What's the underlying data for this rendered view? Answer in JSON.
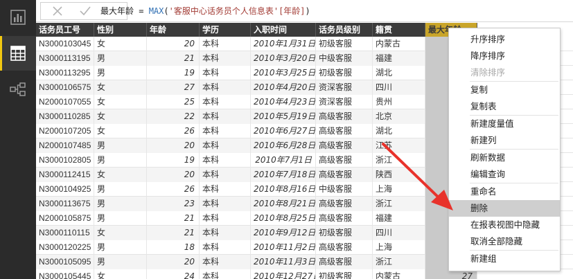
{
  "formula": {
    "measure": "最大年龄",
    "op": " = ",
    "fn": "MAX",
    "open": "(",
    "table": "'客服中心话务员个人信息表'",
    "column": "[年龄]",
    "close": ")"
  },
  "columns": [
    "话务员工号",
    "性别",
    "年龄",
    "学历",
    "入职时间",
    "话务员级别",
    "籍贯",
    "最大年龄"
  ],
  "rows": [
    [
      "N3000103045",
      "女",
      "20",
      "本科",
      "2010年1月31日",
      "初级客服",
      "内蒙古",
      ""
    ],
    [
      "N3000113195",
      "男",
      "21",
      "本科",
      "2010年3月20日",
      "中级客服",
      "福建",
      ""
    ],
    [
      "N3000113295",
      "男",
      "19",
      "本科",
      "2010年3月25日",
      "初级客服",
      "湖北",
      ""
    ],
    [
      "N3000106575",
      "女",
      "27",
      "本科",
      "2010年4月20日",
      "资深客服",
      "四川",
      ""
    ],
    [
      "N2000107055",
      "女",
      "25",
      "本科",
      "2010年4月23日",
      "资深客服",
      "贵州",
      ""
    ],
    [
      "N3000110285",
      "女",
      "22",
      "本科",
      "2010年5月19日",
      "高级客服",
      "北京",
      ""
    ],
    [
      "N2000107205",
      "女",
      "26",
      "本科",
      "2010年6月27日",
      "高级客服",
      "湖北",
      ""
    ],
    [
      "N2000107485",
      "男",
      "20",
      "本科",
      "2010年6月28日",
      "高级客服",
      "江苏",
      ""
    ],
    [
      "N3000102805",
      "男",
      "19",
      "本科",
      "2010年7月1日",
      "高级客服",
      "浙江",
      ""
    ],
    [
      "N3000112415",
      "女",
      "20",
      "本科",
      "2010年7月18日",
      "高级客服",
      "陕西",
      ""
    ],
    [
      "N3000104925",
      "男",
      "26",
      "本科",
      "2010年8月16日",
      "中级客服",
      "上海",
      ""
    ],
    [
      "N3000113675",
      "男",
      "23",
      "本科",
      "2010年8月21日",
      "高级客服",
      "浙江",
      ""
    ],
    [
      "N2000105875",
      "男",
      "21",
      "本科",
      "2010年8月25日",
      "高级客服",
      "福建",
      ""
    ],
    [
      "N3000110115",
      "女",
      "21",
      "本科",
      "2010年9月12日",
      "初级客服",
      "四川",
      ""
    ],
    [
      "N3000120225",
      "男",
      "18",
      "本科",
      "2010年11月2日",
      "高级客服",
      "上海",
      ""
    ],
    [
      "N3000105095",
      "男",
      "20",
      "本科",
      "2010年11月3日",
      "高级客服",
      "浙江",
      ""
    ],
    [
      "N3000105445",
      "女",
      "24",
      "本科",
      "2010年12月27日",
      "初级客服",
      "内蒙古",
      "27"
    ]
  ],
  "menu": [
    {
      "label": "升序排序",
      "disabled": false
    },
    {
      "label": "降序排序",
      "disabled": false
    },
    {
      "label": "清除排序",
      "disabled": true
    },
    {
      "sep": true
    },
    {
      "label": "复制",
      "disabled": false
    },
    {
      "label": "复制表",
      "disabled": false
    },
    {
      "sep": true
    },
    {
      "label": "新建度量值",
      "disabled": false
    },
    {
      "label": "新建列",
      "disabled": false
    },
    {
      "sep": true
    },
    {
      "label": "刷新数据",
      "disabled": false
    },
    {
      "label": "编辑查询",
      "disabled": false
    },
    {
      "sep": true
    },
    {
      "label": "重命名",
      "disabled": false
    },
    {
      "label": "删除",
      "disabled": false,
      "hover": true
    },
    {
      "label": "在报表视图中隐藏",
      "disabled": false
    },
    {
      "label": "取消全部隐藏",
      "disabled": false
    },
    {
      "sep": true
    },
    {
      "label": "新建组",
      "disabled": false
    }
  ],
  "rail": [
    {
      "icon": "report-view-icon",
      "active": false
    },
    {
      "icon": "data-view-icon",
      "active": true
    },
    {
      "icon": "relationship-view-icon",
      "active": false
    }
  ],
  "colors": {
    "accent": "#f2c811",
    "header": "#3b3b3b",
    "selected_header": "#c9a52a",
    "arrow": "#e8322b"
  }
}
